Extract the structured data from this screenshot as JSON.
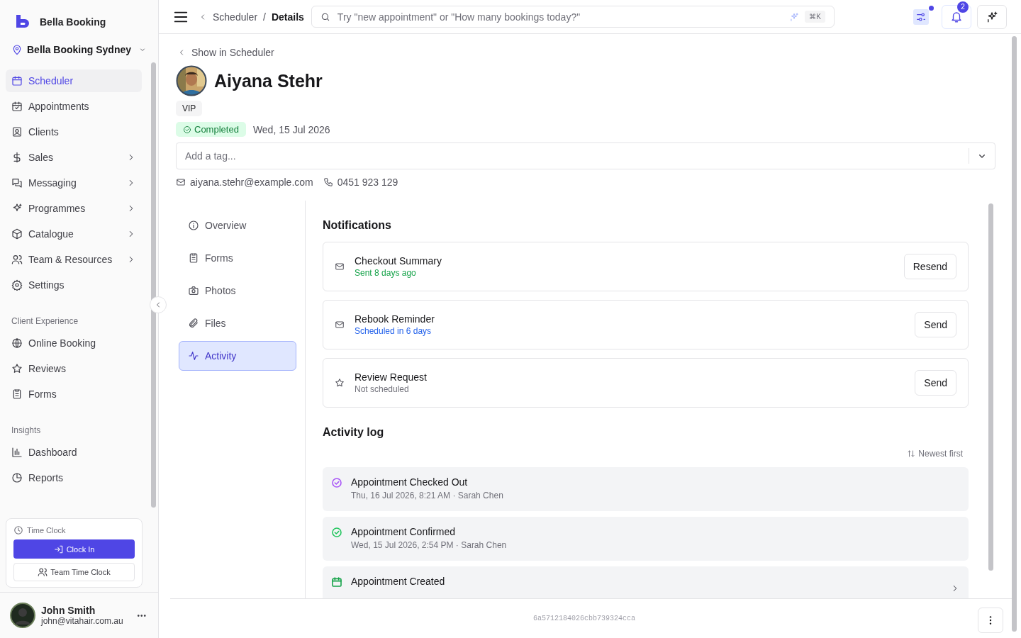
{
  "brand": {
    "name": "Bella Booking"
  },
  "location": {
    "name": "Bella Booking Sydney"
  },
  "sidebar": {
    "sections": [
      {
        "items": [
          {
            "label": "Scheduler",
            "selected": true,
            "has_submenu": false
          },
          {
            "label": "Appointments",
            "selected": false,
            "has_submenu": false
          },
          {
            "label": "Clients",
            "selected": false,
            "has_submenu": false
          },
          {
            "label": "Sales",
            "selected": false,
            "has_submenu": true
          },
          {
            "label": "Messaging",
            "selected": false,
            "has_submenu": true
          },
          {
            "label": "Programmes",
            "selected": false,
            "has_submenu": true
          },
          {
            "label": "Catalogue",
            "selected": false,
            "has_submenu": true
          },
          {
            "label": "Team & Resources",
            "selected": false,
            "has_submenu": true
          },
          {
            "label": "Settings",
            "selected": false,
            "has_submenu": false
          }
        ]
      },
      {
        "heading": "Client Experience",
        "items": [
          {
            "label": "Online Booking",
            "selected": false,
            "has_submenu": false
          },
          {
            "label": "Reviews",
            "selected": false,
            "has_submenu": false
          },
          {
            "label": "Forms",
            "selected": false,
            "has_submenu": false
          }
        ]
      },
      {
        "heading": "Insights",
        "items": [
          {
            "label": "Dashboard",
            "selected": false,
            "has_submenu": false
          },
          {
            "label": "Reports",
            "selected": false,
            "has_submenu": false
          }
        ]
      }
    ]
  },
  "time_clock": {
    "title": "Time Clock",
    "primary": "Clock In",
    "secondary": "Team Time Clock"
  },
  "user": {
    "name": "John Smith",
    "email": "john@vitahair.com.au",
    "menu": "•••"
  },
  "topbar": {
    "breadcrumb": [
      "Scheduler",
      "/",
      "Details"
    ],
    "search": {
      "placeholder": "Try \"new appointment\" or \"How many bookings today?\"",
      "shortcut": "⌘K"
    },
    "filter_dot": true,
    "notifications_count": "2"
  },
  "client": {
    "back": "Show in Scheduler",
    "name": "Aiyana Stehr",
    "tag": "VIP",
    "status": "Completed",
    "date": "Wed, 15 Jul 2026",
    "tag_field": {
      "placeholder": "Add a tag..."
    },
    "email": "aiyana.stehr@example.com",
    "phone": "0451 923 129"
  },
  "tabs": [
    {
      "label": "Overview",
      "selected": false
    },
    {
      "label": "Forms",
      "selected": false
    },
    {
      "label": "Photos",
      "selected": false
    },
    {
      "label": "Files",
      "selected": false
    },
    {
      "label": "Activity",
      "selected": true
    }
  ],
  "notifications": {
    "title": "Notifications",
    "items": [
      {
        "kind": "sent",
        "title": "Checkout Summary",
        "status": "Sent 8 days ago",
        "action": "Resend"
      },
      {
        "kind": "scheduled",
        "title": "Rebook Reminder",
        "status": "Scheduled in 6 days",
        "action": "Send"
      },
      {
        "kind": "review",
        "title": "Review Request",
        "status": "Not scheduled",
        "action": "Send"
      }
    ]
  },
  "activity_log": {
    "title": "Activity log",
    "sort": "Newest first",
    "items": [
      {
        "kind": "check",
        "color": "#a855f7",
        "title": "Appointment Checked Out",
        "meta": "Thu, 16 Jul 2026, 8:21 AM · Sarah Chen",
        "expandable": false
      },
      {
        "kind": "check",
        "color": "#22c55e",
        "title": "Appointment Confirmed",
        "meta": "Wed, 15 Jul 2026, 2:54 PM · Sarah Chen",
        "expandable": false
      },
      {
        "kind": "calendar",
        "color": "#16a34a",
        "title": "Appointment Created",
        "expandable": true
      }
    ]
  },
  "footer": {
    "id": "6a5712184026cbb739324cca"
  }
}
